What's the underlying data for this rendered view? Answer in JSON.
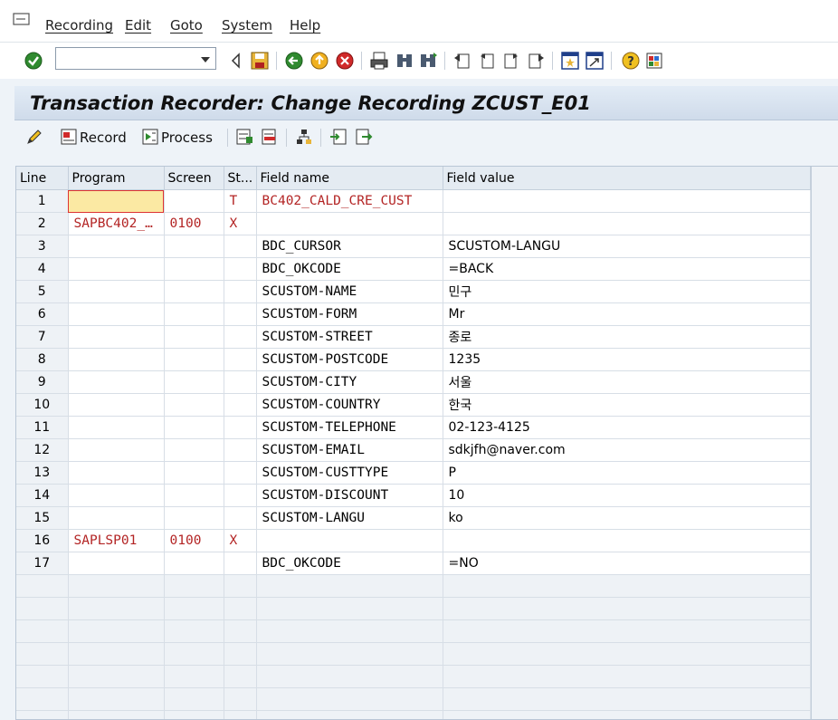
{
  "menubar": {
    "items": [
      "Recording",
      "Edit",
      "Goto",
      "System",
      "Help"
    ]
  },
  "toolbar": {
    "command_field_value": "",
    "icons": [
      "enter-icon",
      "back-icon",
      "save-icon",
      "back-green-icon",
      "exit-icon",
      "cancel-icon",
      "print-icon",
      "find-icon",
      "find-next-icon",
      "first-page-icon",
      "prev-page-icon",
      "next-page-icon",
      "last-page-icon",
      "new-session-icon",
      "shortcut-icon",
      "help-icon",
      "customize-icon"
    ]
  },
  "title": "Transaction Recorder: Change Recording ZCUST_E01",
  "app_toolbar": {
    "record_label": "Record",
    "process_label": "Process"
  },
  "table": {
    "headers": [
      "Line",
      "Program",
      "Screen",
      "St...",
      "Field name",
      "Field value"
    ],
    "rows": [
      {
        "line": "1",
        "program": "",
        "screen": "",
        "st": "T",
        "field": "BC402_CALD_CRE_CUST",
        "value": ""
      },
      {
        "line": "2",
        "program": "SAPBC402_…",
        "screen": "0100",
        "st": "X",
        "field": "",
        "value": ""
      },
      {
        "line": "3",
        "program": "",
        "screen": "",
        "st": "",
        "field": "BDC_CURSOR",
        "value": "SCUSTOM-LANGU"
      },
      {
        "line": "4",
        "program": "",
        "screen": "",
        "st": "",
        "field": "BDC_OKCODE",
        "value": "=BACK"
      },
      {
        "line": "5",
        "program": "",
        "screen": "",
        "st": "",
        "field": "SCUSTOM-NAME",
        "value": "민구"
      },
      {
        "line": "6",
        "program": "",
        "screen": "",
        "st": "",
        "field": "SCUSTOM-FORM",
        "value": "Mr"
      },
      {
        "line": "7",
        "program": "",
        "screen": "",
        "st": "",
        "field": "SCUSTOM-STREET",
        "value": "종로"
      },
      {
        "line": "8",
        "program": "",
        "screen": "",
        "st": "",
        "field": "SCUSTOM-POSTCODE",
        "value": "1235"
      },
      {
        "line": "9",
        "program": "",
        "screen": "",
        "st": "",
        "field": "SCUSTOM-CITY",
        "value": "서울"
      },
      {
        "line": "10",
        "program": "",
        "screen": "",
        "st": "",
        "field": "SCUSTOM-COUNTRY",
        "value": "한국"
      },
      {
        "line": "11",
        "program": "",
        "screen": "",
        "st": "",
        "field": "SCUSTOM-TELEPHONE",
        "value": "02-123-4125"
      },
      {
        "line": "12",
        "program": "",
        "screen": "",
        "st": "",
        "field": "SCUSTOM-EMAIL",
        "value": "sdkjfh@naver.com"
      },
      {
        "line": "13",
        "program": "",
        "screen": "",
        "st": "",
        "field": "SCUSTOM-CUSTTYPE",
        "value": "P"
      },
      {
        "line": "14",
        "program": "",
        "screen": "",
        "st": "",
        "field": "SCUSTOM-DISCOUNT",
        "value": "10"
      },
      {
        "line": "15",
        "program": "",
        "screen": "",
        "st": "",
        "field": "SCUSTOM-LANGU",
        "value": "ko"
      },
      {
        "line": "16",
        "program": "SAPLSP01",
        "screen": "0100",
        "st": "X",
        "field": "",
        "value": ""
      },
      {
        "line": "17",
        "program": "",
        "screen": "",
        "st": "",
        "field": "BDC_OKCODE",
        "value": "=NO"
      }
    ]
  },
  "colors": {
    "title_bar": "#d6e1ee",
    "red_text": "#b32424",
    "highlight_cell": "#fbe9a3"
  }
}
